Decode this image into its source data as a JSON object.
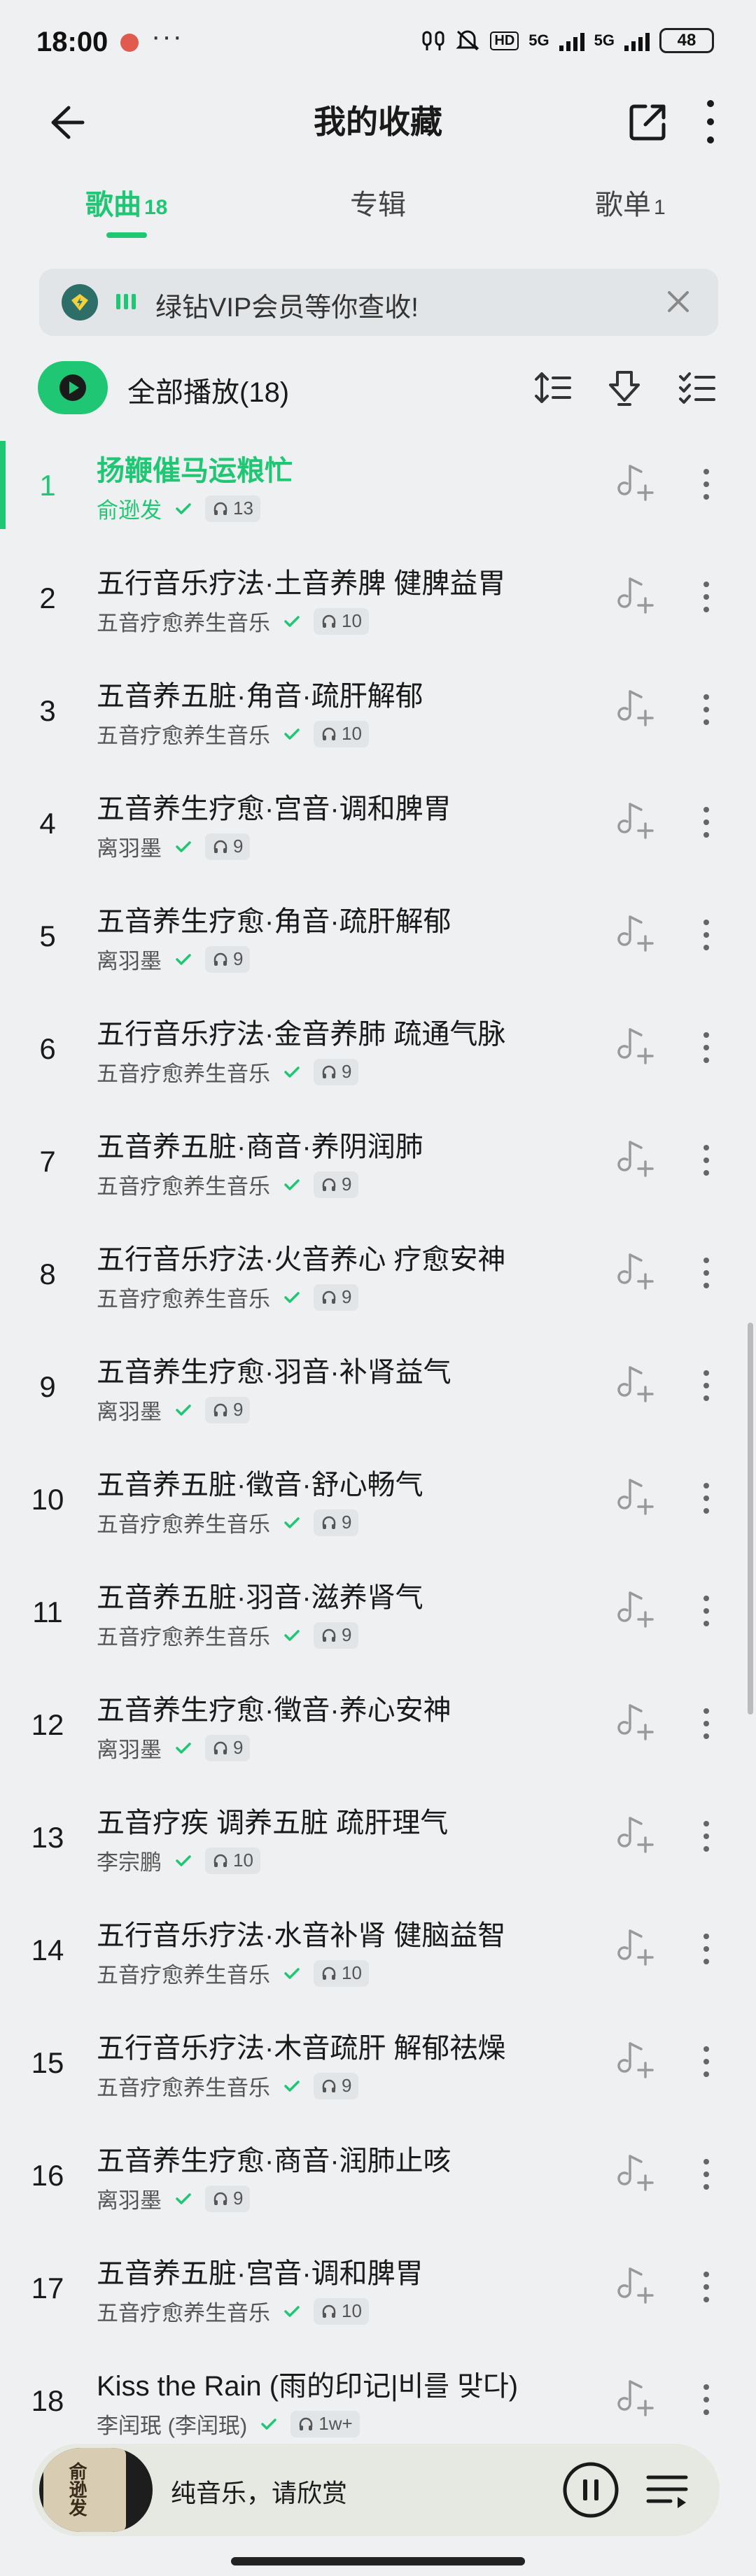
{
  "status": {
    "time": "18:00",
    "more": "···",
    "net1": "5G",
    "net2": "5G",
    "hd": "HD",
    "battery": "48"
  },
  "header": {
    "title": "我的收藏"
  },
  "tabs": [
    {
      "label": "歌曲",
      "count": "18"
    },
    {
      "label": "专辑",
      "count": ""
    },
    {
      "label": "歌单",
      "count": "1"
    }
  ],
  "vip": {
    "text": "绿钻VIP会员等你查收!"
  },
  "playbar": {
    "label": "全部播放(18)"
  },
  "songs": [
    {
      "index": "1",
      "title": "扬鞭催马运粮忙",
      "artist": "俞逊发",
      "plays": "13"
    },
    {
      "index": "2",
      "title": "五行音乐疗法·土音养脾 健脾益胃",
      "artist": "五音疗愈养生音乐",
      "plays": "10"
    },
    {
      "index": "3",
      "title": "五音养五脏·角音·疏肝解郁",
      "artist": "五音疗愈养生音乐",
      "plays": "10"
    },
    {
      "index": "4",
      "title": "五音养生疗愈·宫音·调和脾胃",
      "artist": "离羽墨",
      "plays": "9"
    },
    {
      "index": "5",
      "title": "五音养生疗愈·角音·疏肝解郁",
      "artist": "离羽墨",
      "plays": "9"
    },
    {
      "index": "6",
      "title": "五行音乐疗法·金音养肺 疏通气脉",
      "artist": "五音疗愈养生音乐",
      "plays": "9"
    },
    {
      "index": "7",
      "title": "五音养五脏·商音·养阴润肺",
      "artist": "五音疗愈养生音乐",
      "plays": "9"
    },
    {
      "index": "8",
      "title": "五行音乐疗法·火音养心 疗愈安神",
      "artist": "五音疗愈养生音乐",
      "plays": "9"
    },
    {
      "index": "9",
      "title": "五音养生疗愈·羽音·补肾益气",
      "artist": "离羽墨",
      "plays": "9"
    },
    {
      "index": "10",
      "title": "五音养五脏·徵音·舒心畅气",
      "artist": "五音疗愈养生音乐",
      "plays": "9"
    },
    {
      "index": "11",
      "title": "五音养五脏·羽音·滋养肾气",
      "artist": "五音疗愈养生音乐",
      "plays": "9"
    },
    {
      "index": "12",
      "title": "五音养生疗愈·徵音·养心安神",
      "artist": "离羽墨",
      "plays": "9"
    },
    {
      "index": "13",
      "title": "五音疗疾 调养五脏 疏肝理气",
      "artist": "李宗鹏",
      "plays": "10"
    },
    {
      "index": "14",
      "title": "五行音乐疗法·水音补肾 健脑益智",
      "artist": "五音疗愈养生音乐",
      "plays": "10"
    },
    {
      "index": "15",
      "title": "五行音乐疗法·木音疏肝 解郁祛燥",
      "artist": "五音疗愈养生音乐",
      "plays": "9"
    },
    {
      "index": "16",
      "title": "五音养生疗愈·商音·润肺止咳",
      "artist": "离羽墨",
      "plays": "9"
    },
    {
      "index": "17",
      "title": "五音养五脏·宫音·调和脾胃",
      "artist": "五音疗愈养生音乐",
      "plays": "10"
    },
    {
      "index": "18",
      "title": "Kiss the Rain (雨的印记|비를 맞다)",
      "artist": "李闰珉 (李闰珉)",
      "plays": "1w+"
    }
  ],
  "player": {
    "now_playing": "纯音乐，请欣赏",
    "cover_text": "俞逊发"
  },
  "colors": {
    "accent": "#1fc673",
    "background": "#eef0f2"
  }
}
